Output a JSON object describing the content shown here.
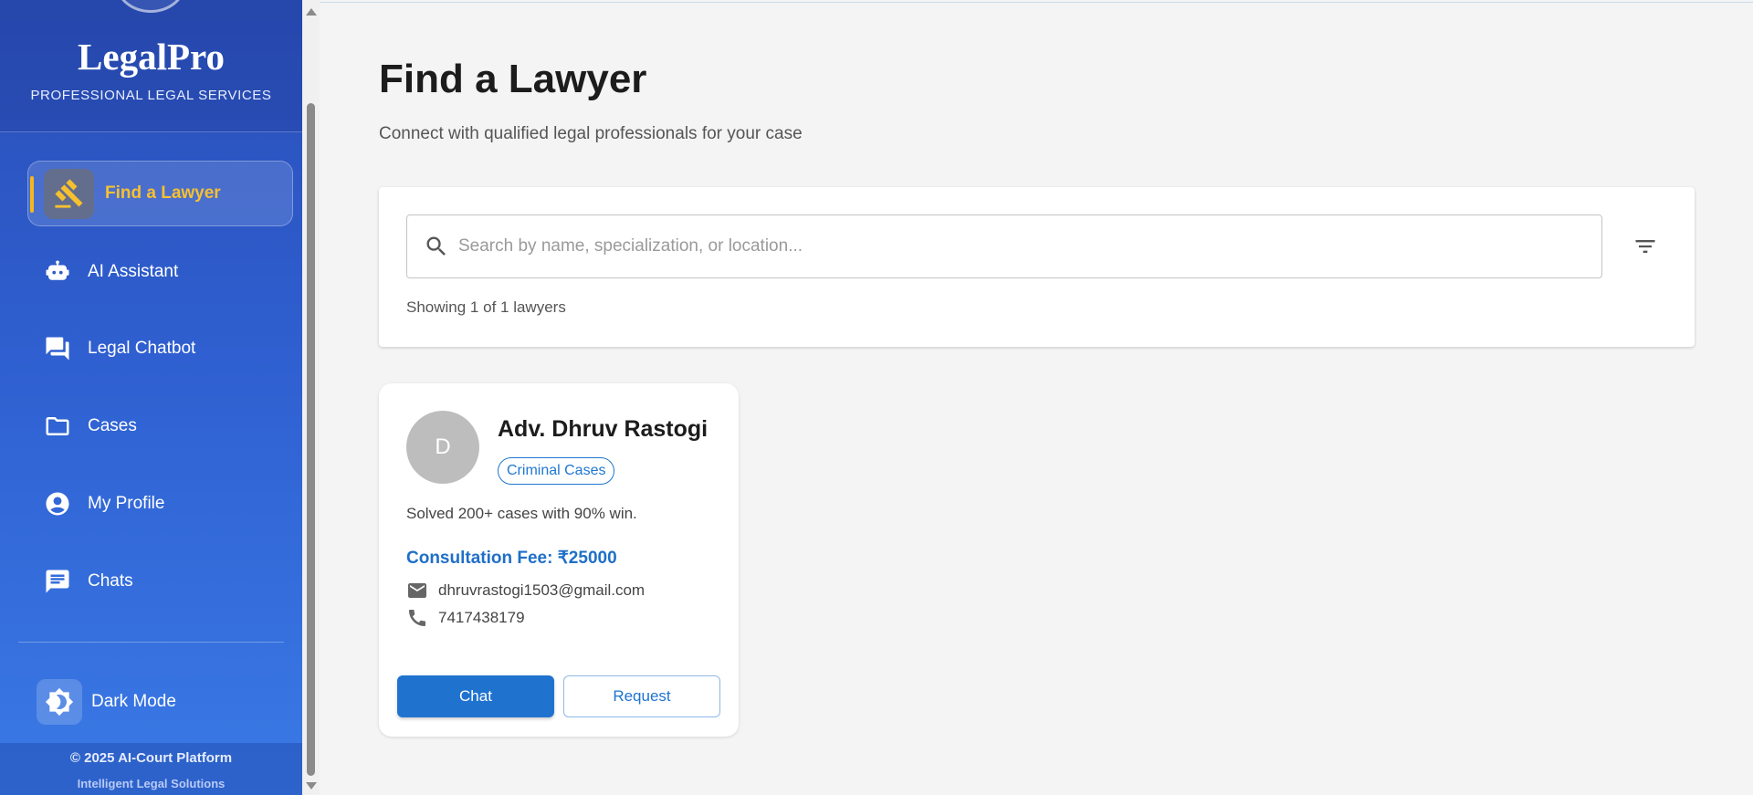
{
  "sidebar": {
    "brand_title": "LegalPro",
    "brand_subtitle": "PROFESSIONAL LEGAL SERVICES",
    "items": [
      {
        "label": "Find a Lawyer",
        "icon": "gavel-icon",
        "active": true
      },
      {
        "label": "AI Assistant",
        "icon": "robot-icon"
      },
      {
        "label": "Legal Chatbot",
        "icon": "forum-icon"
      },
      {
        "label": "Cases",
        "icon": "folder-icon"
      },
      {
        "label": "My Profile",
        "icon": "account-circle-icon"
      },
      {
        "label": "Chats",
        "icon": "chat-icon"
      }
    ],
    "dark_mode_label": "Dark Mode",
    "footer_line1": "© 2025 AI-Court Platform",
    "footer_line2": "Intelligent Legal Solutions"
  },
  "main": {
    "title": "Find a Lawyer",
    "subtitle": "Connect with qualified legal professionals for your case",
    "search": {
      "placeholder": "Search by name, specialization, or location...",
      "value": ""
    },
    "results_text": "Showing 1 of 1 lawyers"
  },
  "lawyers": [
    {
      "initial": "D",
      "name": "Adv. Dhruv Rastogi",
      "specialization": "Criminal Cases",
      "bio": "Solved 200+ cases with 90% win.",
      "fee": "Consultation Fee: ₹25000",
      "email": "dhruvrastogi1503@gmail.com",
      "phone": "7417438179",
      "chat_label": "Chat",
      "request_label": "Request"
    }
  ],
  "colors": {
    "sidebar_top": "#2a4fb8",
    "sidebar_bottom": "#3a7ae6",
    "active_accent": "#f6c030",
    "primary": "#1f73cf"
  }
}
